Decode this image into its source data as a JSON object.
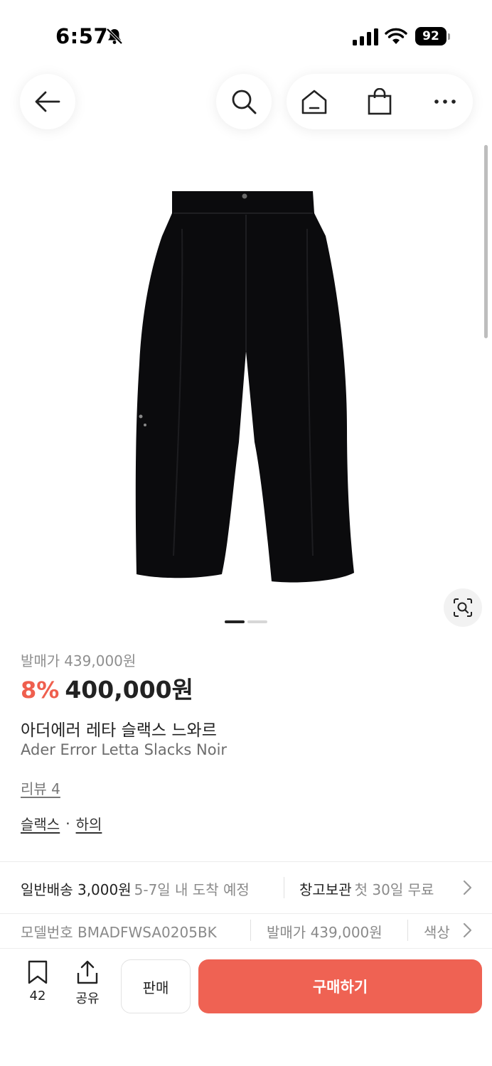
{
  "status": {
    "time": "6:57",
    "battery": "92"
  },
  "product": {
    "release_label": "발매가",
    "release_price": "439,000원",
    "discount": "8%",
    "price": "400,000원",
    "name_ko": "아더에러 레타 슬랙스 느와르",
    "name_en": "Ader Error Letta Slacks Noir",
    "review": "리뷰 4",
    "category_1": "슬랙스",
    "category_sep": "·",
    "category_2": "하의",
    "image_pages": 2,
    "image_current": 1
  },
  "shipping": {
    "label": "일반배송",
    "price": "3,000원",
    "eta": "5-7일 내 도착 예정",
    "storage_label": "창고보관",
    "storage_detail": "첫 30일 무료"
  },
  "model": {
    "model_label": "모델번호",
    "model_value": "BMADFWSA0205BK",
    "release_label": "발매가",
    "release_value": "439,000원",
    "color_label": "색상"
  },
  "bottom": {
    "bookmark_count": "42",
    "share_label": "공유",
    "sell_label": "판매",
    "buy_label": "구매하기"
  },
  "colors": {
    "accent": "#ef5f4e",
    "buy_button": "#ef6253",
    "text": "#222222",
    "muted": "#8a8a8a"
  }
}
